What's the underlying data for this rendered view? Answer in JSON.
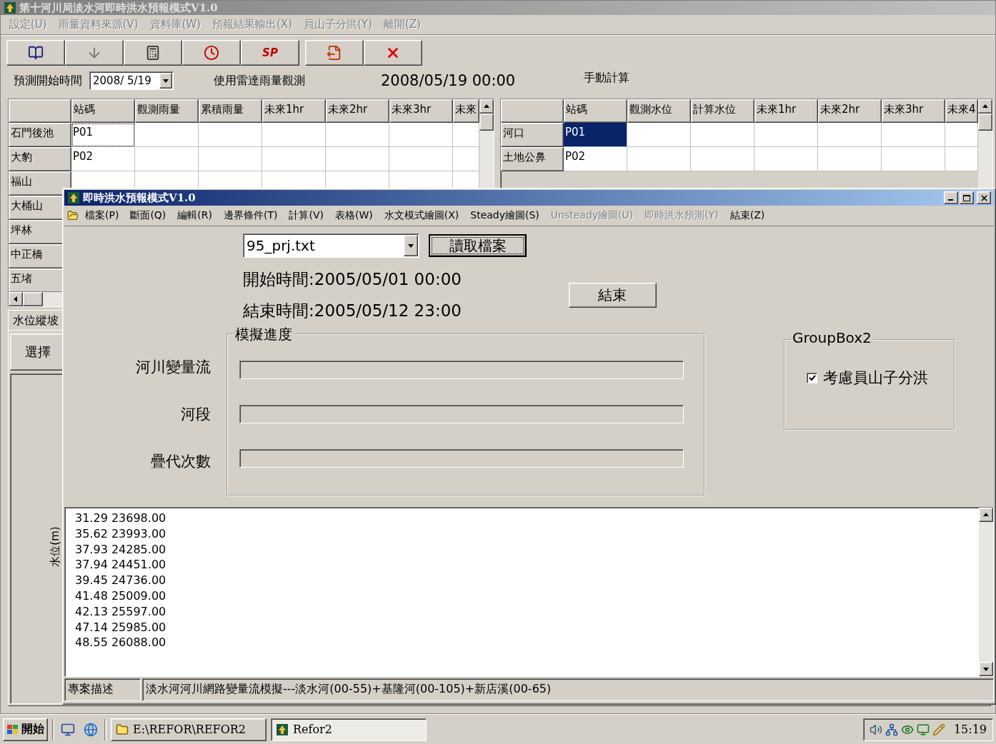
{
  "main_window": {
    "title": "第十河川局淡水河即時洪水預報模式V1.0",
    "menu": [
      {
        "label": "設定(U)",
        "disabled": true
      },
      {
        "label": "雨量資料來源(V)",
        "disabled": true
      },
      {
        "label": "資料庫(W)",
        "disabled": true
      },
      {
        "label": "預報結果輸出(X)",
        "disabled": true
      },
      {
        "label": "員山子分洪(Y)",
        "disabled": true
      },
      {
        "label": "離開(Z)",
        "disabled": true
      }
    ],
    "toolbar": [
      [
        {
          "kind": "book"
        },
        {
          "kind": "arrow-down"
        },
        {
          "kind": "calculator"
        },
        {
          "kind": "clock"
        },
        {
          "kind": "sp",
          "text": "SP"
        }
      ],
      [
        {
          "kind": "export"
        },
        {
          "kind": "delete"
        }
      ]
    ],
    "forecast_start": {
      "label": "預測開始時間",
      "value": "2008/ 5/19"
    },
    "radar_label": "使用雷達雨量觀測",
    "current_time": "2008/05/19 00:00",
    "mode_label": "手動計算",
    "rain_grid": {
      "columns": [
        "站碼",
        "觀測雨量",
        "累積雨量",
        "未來1hr",
        "未來2hr",
        "未來3hr",
        "未來"
      ],
      "rows": [
        {
          "station": "石門後池",
          "code": "P01",
          "focused": true
        },
        {
          "station": "大豹",
          "code": "P02",
          "focused": false
        },
        {
          "station": "福山",
          "focused": false
        },
        {
          "station": "大桶山"
        },
        {
          "station": "坪林"
        },
        {
          "station": "中正橋"
        },
        {
          "station": "五堵"
        }
      ]
    },
    "water_grid": {
      "columns": [
        "站碼",
        "觀測水位",
        "計算水位",
        "未來1hr",
        "未來2hr",
        "未來3hr",
        "未來4"
      ],
      "rows": [
        {
          "station": "河口",
          "code": "P01",
          "selected": true
        },
        {
          "station": "土地公鼻",
          "code": "P02",
          "selected": false
        }
      ]
    },
    "tabs": [
      {
        "label": "水位縱坡",
        "selected": true
      }
    ],
    "select_button": "選擇",
    "chart_panel": {
      "ylabel": "水位(m)"
    }
  },
  "dialog": {
    "title": "即時洪水預報模式V1.0",
    "menu": [
      {
        "label": "檔案(P)",
        "disabled": false
      },
      {
        "label": "斷面(Q)",
        "disabled": false
      },
      {
        "label": "編輯(R)",
        "disabled": false
      },
      {
        "label": "邊界條件(T)",
        "disabled": false
      },
      {
        "label": "計算(V)",
        "disabled": false
      },
      {
        "label": "表格(W)",
        "disabled": false
      },
      {
        "label": "水文模式繪圖(X)",
        "disabled": false
      },
      {
        "label": "Steady繪圖(S)",
        "disabled": false
      },
      {
        "label": "Unsteady繪圖(U)",
        "disabled": true
      },
      {
        "label": "即時洪水預測(Y)",
        "disabled": true
      },
      {
        "label": "結束(Z)",
        "disabled": false
      }
    ],
    "project_file": "95_prj.txt",
    "read_button": "讀取檔案",
    "start_time": "開始時間:2005/05/01 00:00",
    "end_time": "結束時間:2005/05/12 23:00",
    "end_button": "結束",
    "progress": {
      "title": "模擬進度",
      "bars": [
        {
          "label": "河川變量流",
          "level": 0
        },
        {
          "label": "河段",
          "level": 0
        },
        {
          "label": "疊代次數",
          "level": 0
        }
      ]
    },
    "groupbox": {
      "title": "GroupBox2",
      "checkbox": {
        "label": "考慮員山子分洪",
        "checked": true
      }
    },
    "output_lines": [
      "31.29 23698.00",
      "35.62 23993.00",
      "37.93 24285.00",
      "37.94 24451.00",
      "39.45 24736.00",
      "41.48 25009.00",
      "42.13 25597.00",
      "47.14 25985.00",
      "48.55 26088.00"
    ],
    "status_bar": {
      "label": "專案描述",
      "description": "淡水河河川網路變量流模擬---淡水河(00-55)+基隆河(00-105)+新店溪(00-65)"
    }
  },
  "taskbar": {
    "start": "開始",
    "tasks": [
      {
        "label": "E:\\REFOR\\REFOR2",
        "kind": "folder",
        "selected": false
      },
      {
        "label": "Refor2",
        "kind": "app",
        "selected": true
      }
    ],
    "clock": "15:19"
  }
}
